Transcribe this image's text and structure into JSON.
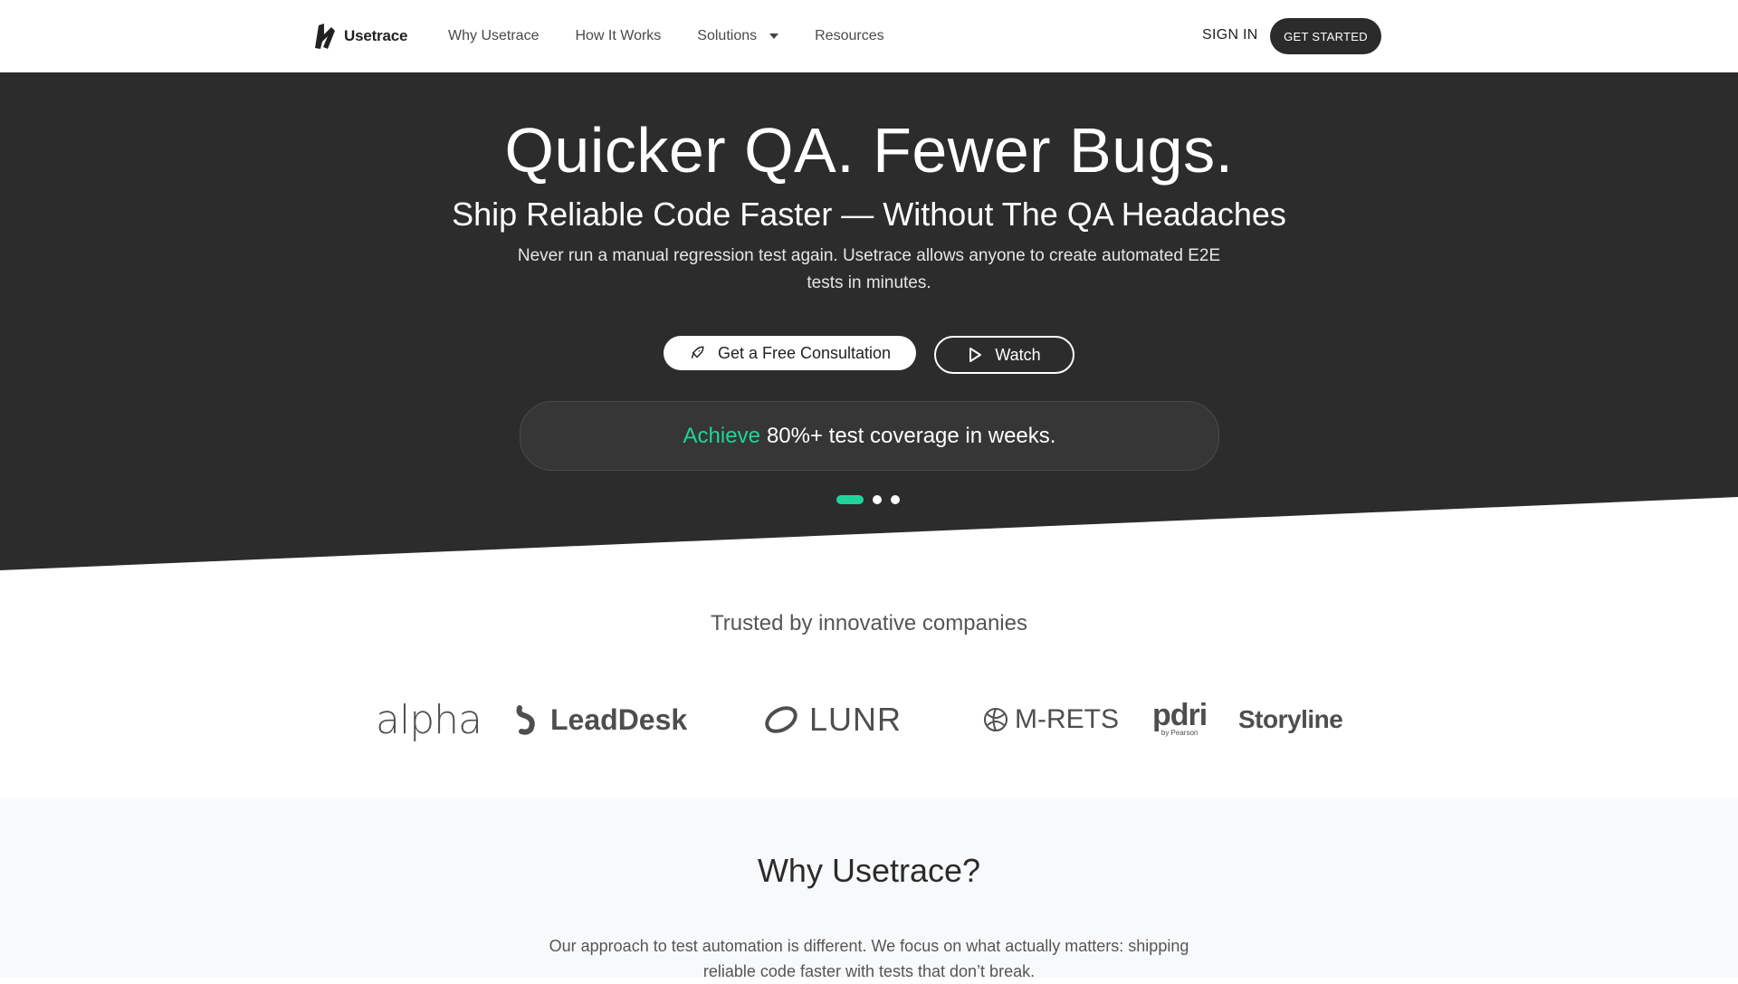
{
  "nav": {
    "brand": "Usetrace",
    "links": [
      {
        "label": "Why Usetrace"
      },
      {
        "label": "How It Works"
      },
      {
        "label": "Solutions",
        "has_dropdown": true
      },
      {
        "label": "Resources"
      }
    ],
    "signin": "SIGN IN",
    "get_started": "GET STARTED"
  },
  "hero": {
    "title": "Quicker QA. Fewer Bugs.",
    "subtitle": "Ship Reliable Code Faster — Without The QA Headaches",
    "description": "Never run a manual regression test again. Usetrace allows anyone to create automated E2E tests in minutes.",
    "consult_button": "Get a Free Consultation",
    "watch_button": "Watch",
    "banner": {
      "accent": "Achieve",
      "text": "80%+ test coverage in weeks."
    },
    "carousel": {
      "total": 3,
      "active_index": 0
    }
  },
  "trusted": {
    "title": "Trusted by innovative companies",
    "logos": [
      {
        "name": "alpha",
        "text": "alpha"
      },
      {
        "name": "LeadDesk",
        "text": "LeadDesk"
      },
      {
        "name": "LUNR",
        "text": "LUNR"
      },
      {
        "name": "M-RETS",
        "text": "M-RETS"
      },
      {
        "name": "pdri",
        "text": "pdri",
        "subtext": "by Pearson"
      },
      {
        "name": "Storyline",
        "text": "Storyline"
      }
    ]
  },
  "why": {
    "title": "Why Usetrace?",
    "description": "Our approach to test automation is different. We focus on what actually matters: shipping reliable code faster with tests that don’t break."
  },
  "colors": {
    "hero_bg": "#2c2c2c",
    "accent": "#1fd49a",
    "dark_button": "#2b2b2b",
    "section_bg": "#f8f9fa"
  }
}
